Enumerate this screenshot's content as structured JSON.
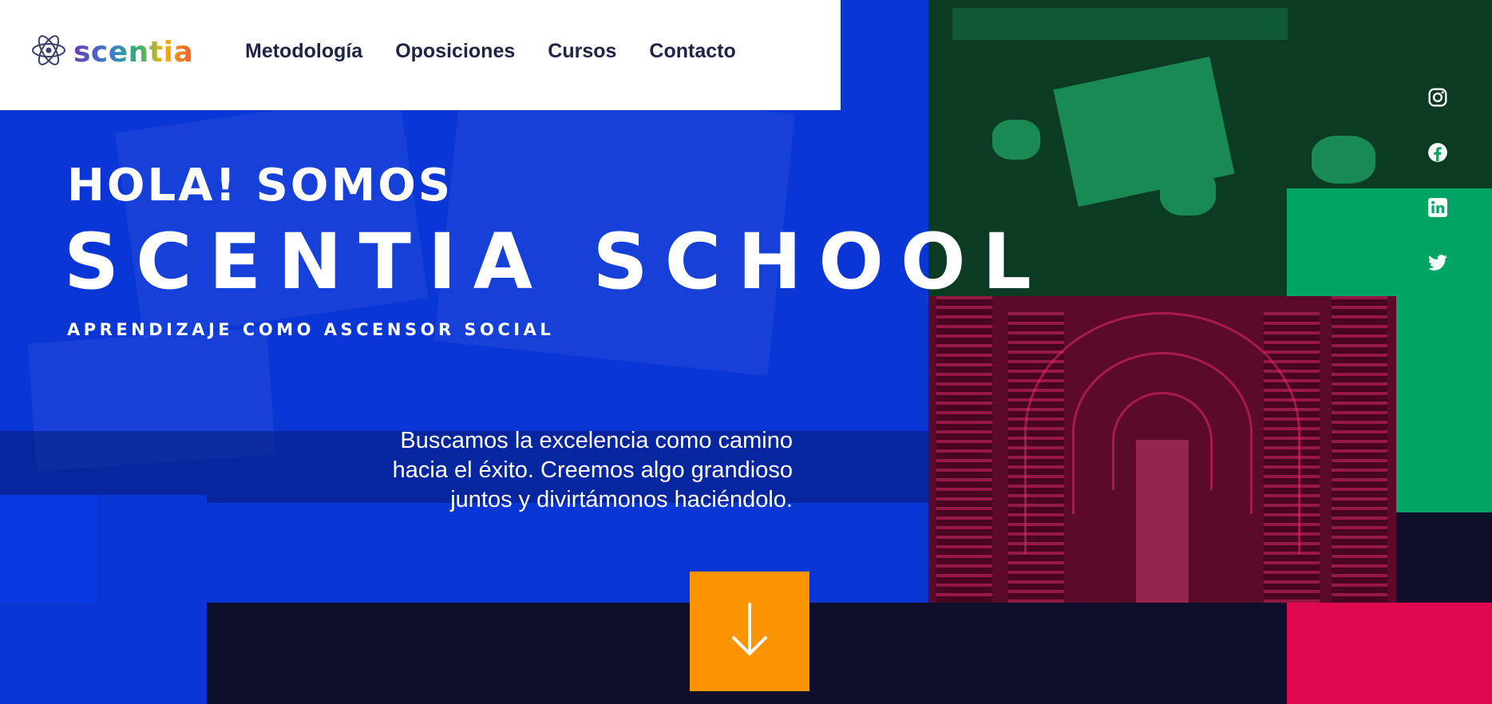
{
  "brand": {
    "name": "scentia",
    "logo_icon": "atom-icon"
  },
  "nav": {
    "items": [
      {
        "label": "Metodología"
      },
      {
        "label": "Oposiciones"
      },
      {
        "label": "Cursos"
      },
      {
        "label": "Contacto"
      }
    ]
  },
  "hero": {
    "kicker": "HOLA! SOMOS",
    "title": "SCENTIA SCHOOL",
    "tagline": "APRENDIZAJE COMO ASCENSOR SOCIAL",
    "body_lines": [
      "Buscamos la excelencia como camino",
      "hacia el éxito. Creemos algo grandioso",
      "juntos y divirtámonos haciéndolo."
    ]
  },
  "scroll_button": {
    "icon": "arrow-down-icon"
  },
  "social": {
    "icons": [
      "instagram-icon",
      "facebook-icon",
      "linkedin-icon",
      "twitter-icon"
    ]
  },
  "colors": {
    "hero_blue": "#0a36d6",
    "green": "#00a564",
    "pink": "#e0094f",
    "orange": "#fb9400",
    "dark_navy": "#0e0f2b",
    "nav_text": "#1f2345"
  }
}
